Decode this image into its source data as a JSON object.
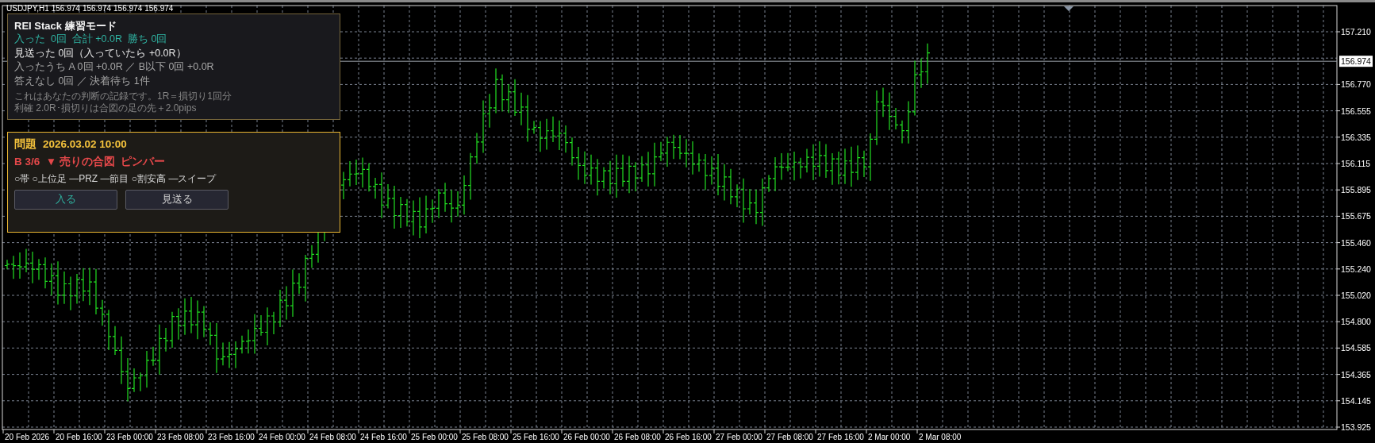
{
  "chart_header": {
    "symbol": "USDJPY,H1",
    "prices": [
      "156.974",
      "156.974",
      "156.974",
      "156.974"
    ]
  },
  "stats_panel": {
    "title": "REI Stack 練習モード",
    "lines": [
      {
        "kind": "highlight",
        "text": "入った  0回  合計 +0.0R  勝ち 0回"
      },
      {
        "kind": "primary",
        "text": "見送った 0回（入っていたら +0.0R）"
      },
      {
        "kind": "secondary",
        "text": "入ったうち A 0回 +0.0R ／ B以下 0回 +0.0R"
      },
      {
        "kind": "secondary",
        "text": "答えなし 0回 ／ 決着待ち 1件"
      },
      {
        "kind": "note",
        "text": "これはあなたの判断の記録です。1R＝損切り1回分"
      },
      {
        "kind": "note",
        "text": "利確 2.0R･損切りは合図の足の先＋2.0pips"
      }
    ]
  },
  "question_panel": {
    "title": "問題",
    "datetime": "2026.03.02 10:00",
    "signal": "B 3/6  ▼ 売りの合図  ピンバー",
    "checklist": "○帯 ○上位足 ―PRZ ―節目 ○割安高 ―スイープ",
    "buttons": [
      {
        "kind": "enter",
        "label": "入る"
      },
      {
        "kind": "skip",
        "label": "見送る"
      }
    ]
  },
  "price_axis": {
    "labels": [
      "157.210",
      "156.770",
      "156.555",
      "156.335",
      "156.115",
      "155.895",
      "155.675",
      "155.460",
      "155.240",
      "155.020",
      "154.800",
      "154.585",
      "154.365",
      "154.145",
      "153.925"
    ],
    "current_price": "156.974"
  },
  "time_axis": {
    "labels": [
      "20 Feb 2026",
      "20 Feb 16:00",
      "23 Feb 00:00",
      "23 Feb 08:00",
      "23 Feb 16:00",
      "24 Feb 00:00",
      "24 Feb 08:00",
      "24 Feb 16:00",
      "25 Feb 00:00",
      "25 Feb 08:00",
      "25 Feb 16:00",
      "26 Feb 00:00",
      "26 Feb 08:00",
      "26 Feb 16:00",
      "27 Feb 00:00",
      "27 Feb 08:00",
      "27 Feb 16:00",
      "2 Mar 00:00",
      "2 Mar 08:00"
    ]
  }
}
